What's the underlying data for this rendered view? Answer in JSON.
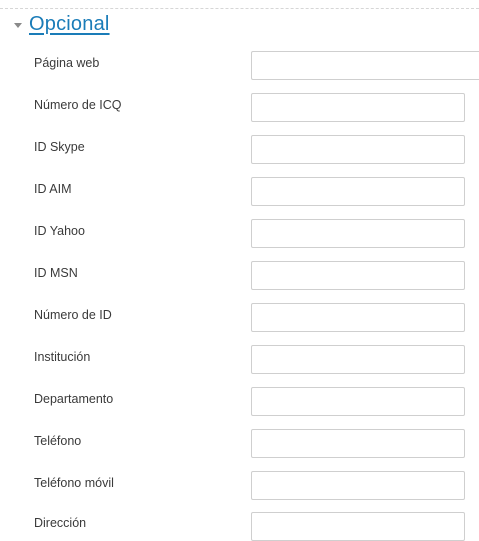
{
  "section": {
    "title": "Opcional",
    "expanded": true
  },
  "fields": [
    {
      "label": "Página web",
      "value": ""
    },
    {
      "label": "Número de ICQ",
      "value": ""
    },
    {
      "label": "ID Skype",
      "value": ""
    },
    {
      "label": "ID AIM",
      "value": ""
    },
    {
      "label": "ID Yahoo",
      "value": ""
    },
    {
      "label": "ID MSN",
      "value": ""
    },
    {
      "label": "Número de ID",
      "value": ""
    },
    {
      "label": "Institución",
      "value": ""
    },
    {
      "label": "Departamento",
      "value": ""
    },
    {
      "label": "Teléfono",
      "value": ""
    },
    {
      "label": "Teléfono móvil",
      "value": ""
    },
    {
      "label": "Dirección",
      "value": ""
    }
  ],
  "colors": {
    "link": "#1a7cb8",
    "input_border": "#cfcfcf",
    "label_text": "#3a3a3a"
  }
}
